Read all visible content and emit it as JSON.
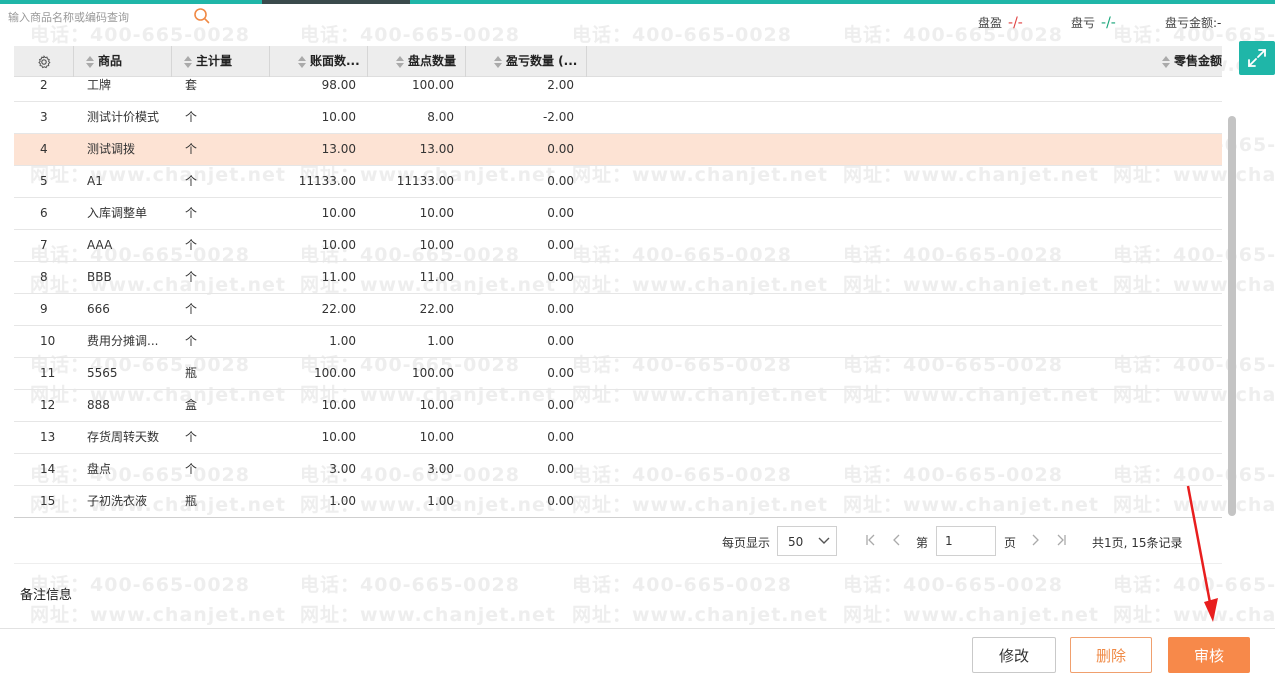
{
  "search": {
    "placeholder": "输入商品名称或编码查询",
    "icon": "search-icon"
  },
  "summary": {
    "gain_label": "盘盈",
    "gain_value": "-/-",
    "loss_label": "盘亏",
    "loss_value": "-/-",
    "loss_amount_label": "盘亏金额:",
    "loss_amount_value": "-"
  },
  "colors": {
    "accent": "#1fb6a8",
    "primary": "#f7894a",
    "gain": "#e04444",
    "loss": "#18a67a",
    "highlight_row": "#fde3d4"
  },
  "grid": {
    "columns": {
      "product": "商品",
      "unit": "主计量",
      "book_qty": "账面数...",
      "count_qty": "盘点数量",
      "diff_qty": "盈亏数量 (...",
      "retail_amount": "零售金额"
    },
    "rows": [
      {
        "no": "2",
        "product": "工牌",
        "unit": "套",
        "book": "98.00",
        "count": "100.00",
        "diff": "2.00"
      },
      {
        "no": "3",
        "product": "测试计价模式",
        "unit": "个",
        "book": "10.00",
        "count": "8.00",
        "diff": "-2.00"
      },
      {
        "no": "4",
        "product": "测试调拨",
        "unit": "个",
        "book": "13.00",
        "count": "13.00",
        "diff": "0.00",
        "selected": true
      },
      {
        "no": "5",
        "product": "A1",
        "unit": "个",
        "book": "11133.00",
        "count": "11133.00",
        "diff": "0.00"
      },
      {
        "no": "6",
        "product": "入库调整单",
        "unit": "个",
        "book": "10.00",
        "count": "10.00",
        "diff": "0.00"
      },
      {
        "no": "7",
        "product": "AAA",
        "unit": "个",
        "book": "10.00",
        "count": "10.00",
        "diff": "0.00"
      },
      {
        "no": "8",
        "product": "BBB",
        "unit": "个",
        "book": "11.00",
        "count": "11.00",
        "diff": "0.00"
      },
      {
        "no": "9",
        "product": "666",
        "unit": "个",
        "book": "22.00",
        "count": "22.00",
        "diff": "0.00"
      },
      {
        "no": "10",
        "product": "费用分摊调...",
        "unit": "个",
        "book": "1.00",
        "count": "1.00",
        "diff": "0.00"
      },
      {
        "no": "11",
        "product": "5565",
        "unit": "瓶",
        "book": "100.00",
        "count": "100.00",
        "diff": "0.00"
      },
      {
        "no": "12",
        "product": "888",
        "unit": "盒",
        "book": "10.00",
        "count": "10.00",
        "diff": "0.00"
      },
      {
        "no": "13",
        "product": "存货周转天数",
        "unit": "个",
        "book": "10.00",
        "count": "10.00",
        "diff": "0.00"
      },
      {
        "no": "14",
        "product": "盘点",
        "unit": "个",
        "book": "3.00",
        "count": "3.00",
        "diff": "0.00"
      },
      {
        "no": "15",
        "product": "子初洗衣液",
        "unit": "瓶",
        "book": "1.00",
        "count": "1.00",
        "diff": "0.00"
      }
    ]
  },
  "pagination": {
    "page_size_label": "每页显示",
    "page_size": "50",
    "page_prefix": "第",
    "current_page": "1",
    "page_suffix": "页",
    "total": "共1页, 15条记录"
  },
  "remarks_label": "备注信息",
  "actions": {
    "edit": "修改",
    "delete": "删除",
    "approve": "审核"
  },
  "watermark": {
    "phone": "电话：400-665-0028",
    "site": "网址：www.chanjet.net"
  }
}
